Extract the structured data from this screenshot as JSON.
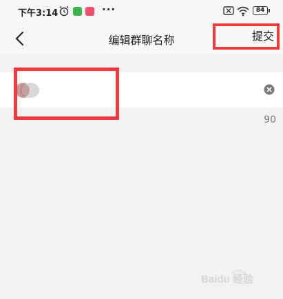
{
  "status_bar": {
    "time": "下午3:14",
    "more": "···",
    "battery": "84"
  },
  "nav": {
    "title": "编辑群聊名称",
    "submit": "提交"
  },
  "form": {
    "name_value": "",
    "char_limit": "90"
  },
  "icons": {
    "back": "chevron-left-icon",
    "clear": "clear-icon",
    "alarm": "alarm-clock-icon",
    "wifi": "wifi-icon",
    "sim": "no-sim-icon",
    "battery": "battery-icon"
  },
  "watermark": {
    "text": "Baidu 经验"
  },
  "colors": {
    "highlight": "#ef3b3f",
    "page_bg": "#f2f2f2",
    "input_bg": "#ffffff"
  }
}
